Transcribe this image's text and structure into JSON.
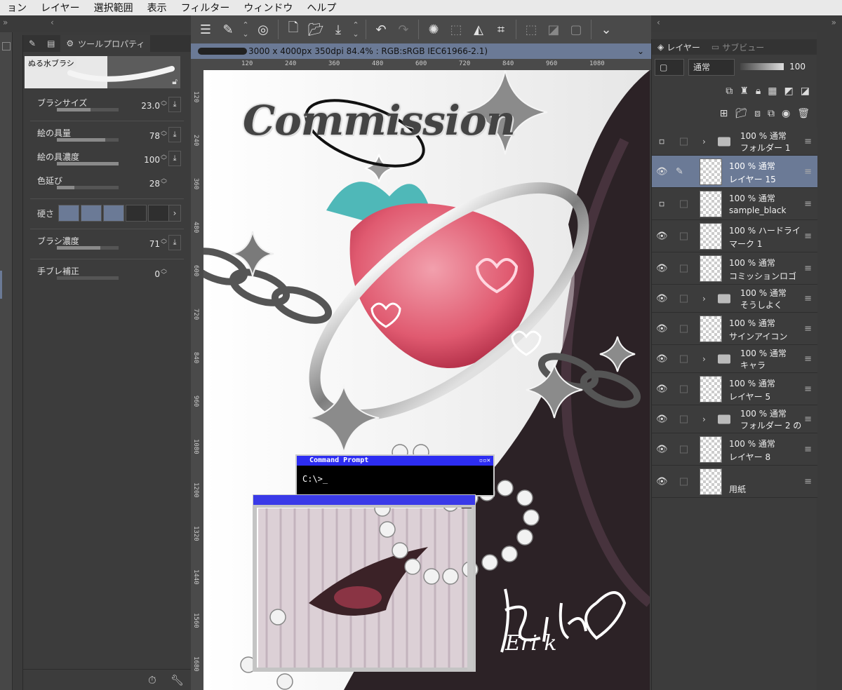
{
  "menubar": [
    "ョン",
    "レイヤー",
    "選択範囲",
    "表示",
    "フィルター",
    "ウィンドウ",
    "ヘルプ"
  ],
  "tool_property": {
    "tab_label": "ツールプロパティ",
    "brush_name": "ぬる水ブラシ",
    "rows": [
      {
        "label": "ブラシサイズ",
        "value": "23.0",
        "level": 0.55
      },
      {
        "label": "絵の具量",
        "value": "78",
        "level": 0.78
      },
      {
        "label": "絵の具濃度",
        "value": "100",
        "level": 1.0
      },
      {
        "label": "色延び",
        "value": "28",
        "level": 0.28
      },
      {
        "label": "ブラシ濃度",
        "value": "71",
        "level": 0.71
      },
      {
        "label": "手ブレ補正",
        "value": "0",
        "level": 0.0
      }
    ],
    "hardness_label": "硬さ",
    "hardness_level": 3
  },
  "document": {
    "title": "3000 x 4000px 350dpi 84.4% : RGB:sRGB IEC61966-2.1)"
  },
  "ruler": {
    "top": [
      "120",
      "240",
      "360",
      "480",
      "600",
      "720",
      "840",
      "960",
      "1080"
    ],
    "left": [
      "120",
      "240",
      "360",
      "480",
      "600",
      "720",
      "840",
      "960",
      "1080",
      "1200",
      "1320",
      "1440",
      "1560",
      "1680"
    ]
  },
  "canvas": {
    "title_text": "Commission",
    "cmd_title": "Command Prompt",
    "cmd_text": "C:\\>_",
    "signature": "Eri k"
  },
  "layer_panel": {
    "tab_layer": "レイヤー",
    "tab_subview": "サブビュー",
    "blend_mode": "通常",
    "opacity": "100",
    "layers": [
      {
        "type": "folder",
        "line1": "100 % 通常",
        "line2": "フォルダー 1",
        "visible": false
      },
      {
        "type": "layer",
        "line1": "100 % 通常",
        "line2": "レイヤー 15",
        "visible": true,
        "selected": true
      },
      {
        "type": "layer",
        "line1": "100 % 通常",
        "line2": "sample_black",
        "visible": false
      },
      {
        "type": "layer",
        "line1": "100 % ハードライ",
        "line2": "マーク 1",
        "visible": true
      },
      {
        "type": "layer",
        "line1": "100 % 通常",
        "line2": "コミッションロゴ",
        "visible": true
      },
      {
        "type": "folder",
        "line1": "100 % 通常",
        "line2": "そうしよく",
        "visible": true
      },
      {
        "type": "layer",
        "line1": "100 % 通常",
        "line2": "サインアイコン",
        "visible": true
      },
      {
        "type": "folder",
        "line1": "100 % 通常",
        "line2": "キャラ",
        "visible": true
      },
      {
        "type": "layer",
        "line1": "100 % 通常",
        "line2": "レイヤー 5",
        "visible": true
      },
      {
        "type": "folder",
        "line1": "100 % 通常",
        "line2": "フォルダー 2 の",
        "visible": true
      },
      {
        "type": "layer",
        "line1": "100 % 通常",
        "line2": "レイヤー 8",
        "visible": true
      },
      {
        "type": "layer",
        "line1": "",
        "line2": "用紙",
        "visible": true
      }
    ]
  },
  "colors": {
    "accent": "#6b7a96",
    "panel": "#3c3c3c",
    "strawberry": "#e05a70"
  }
}
